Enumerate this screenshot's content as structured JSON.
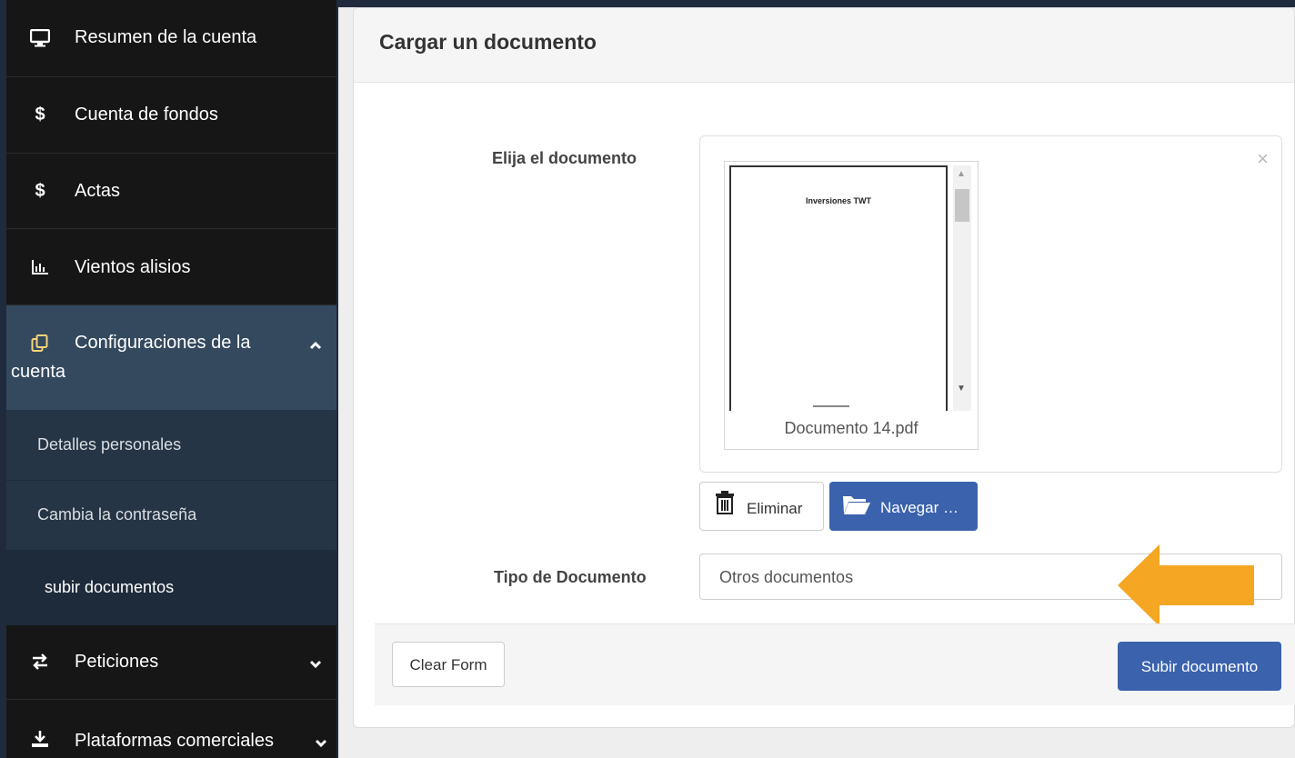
{
  "sidebar": {
    "items": [
      {
        "label": "Resumen de la cuenta",
        "icon": "monitor-icon"
      },
      {
        "label": "Cuenta de fondos",
        "icon": "dollar-icon"
      },
      {
        "label": "Actas",
        "icon": "dollar-icon"
      },
      {
        "label": "Vientos alisios",
        "icon": "bar-chart-icon"
      },
      {
        "label_line1": "Configuraciones de la",
        "label_line2": "cuenta",
        "icon": "copy-icon",
        "expanded": true
      },
      {
        "label": "Peticiones",
        "icon": "exchange-icon"
      },
      {
        "label": "Plataformas comerciales",
        "icon": "download-icon"
      }
    ],
    "subitems": [
      {
        "label": "Detalles personales"
      },
      {
        "label": "Cambia la contraseña"
      },
      {
        "label": "subir documentos",
        "current": true
      }
    ]
  },
  "main": {
    "title": "Cargar un documento",
    "choose_label": "Elija el documento",
    "preview": {
      "doc_heading": "Inversiones TWT",
      "file_name": "Documento 14.pdf",
      "close_symbol": "×"
    },
    "delete_button": "Eliminar",
    "browse_button": "Navegar …",
    "doc_type_label": "Tipo de Documento",
    "doc_type_value": "Otros documentos",
    "clear_button": "Clear Form",
    "submit_button": "Subir documento"
  },
  "colors": {
    "sidebar_bg": "#161616",
    "sidebar_active": "#34495e",
    "primary_button": "#3a62ad",
    "arrow": "#f5a623"
  }
}
